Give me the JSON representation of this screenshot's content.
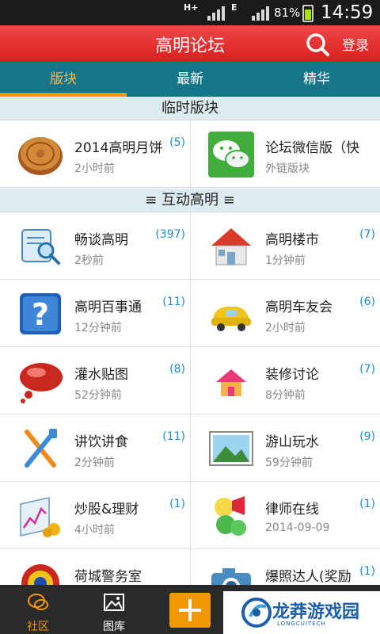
{
  "status_bar": {
    "network_1": "H+",
    "network_2": "E",
    "battery": "81%",
    "time": "14:59"
  },
  "header": {
    "title": "高明论坛",
    "login_label": "登录"
  },
  "tabs": [
    {
      "label": "版块"
    },
    {
      "label": "最新"
    },
    {
      "label": "精华"
    }
  ],
  "sections": [
    {
      "title": "临时版块",
      "boards": [
        {
          "name": "2014高明月饼",
          "time": "2小时前",
          "count": "(5)",
          "icon": "mooncake-icon"
        },
        {
          "name": "论坛微信版（快",
          "time": "外链版块",
          "count": "",
          "icon": "wechat-icon"
        }
      ]
    },
    {
      "title": "≡ 互动高明 ≡",
      "boards": [
        {
          "name": "畅谈高明",
          "time": "2秒前",
          "count": "(397)",
          "icon": "scroll-magnifier-icon"
        },
        {
          "name": "高明楼市",
          "time": "1分钟前",
          "count": "(7)",
          "icon": "house-icon"
        },
        {
          "name": "高明百事通",
          "time": "12分钟前",
          "count": "(11)",
          "icon": "question-mark-icon"
        },
        {
          "name": "高明车友会",
          "time": "2小时前",
          "count": "(6)",
          "icon": "car-icon"
        },
        {
          "name": "灌水贴图",
          "time": "52分钟前",
          "count": "(8)",
          "icon": "speech-bubble-icon"
        },
        {
          "name": "装修讨论",
          "time": "8分钟前",
          "count": "(7)",
          "icon": "pink-house-icon"
        },
        {
          "name": "讲饮讲食",
          "time": "2分钟前",
          "count": "(11)",
          "icon": "utensils-icon"
        },
        {
          "name": "游山玩水",
          "time": "59分钟前",
          "count": "(9)",
          "icon": "landscape-icon"
        },
        {
          "name": "炒股&理财",
          "time": "4小时前",
          "count": "(1)",
          "icon": "stock-chart-icon"
        },
        {
          "name": "律师在线",
          "time": "2014-09-09",
          "count": "(1)",
          "icon": "megaphone-icon"
        },
        {
          "name": "荷城警务室",
          "time": "",
          "count": "",
          "icon": "police-badge-icon"
        },
        {
          "name": "爆照达人(奖励",
          "time": "",
          "count": "(1)",
          "icon": "camera-icon"
        }
      ]
    }
  ],
  "bottom_nav": [
    {
      "label": "社区",
      "icon": "community-icon"
    },
    {
      "label": "图库",
      "icon": "gallery-icon"
    }
  ],
  "watermark": {
    "text": "龙莽游戏园",
    "sub": "LONGCUITECH"
  },
  "colors": {
    "header": "#e02828",
    "tabs": "#17758a",
    "accent": "#f39800",
    "count": "#1a8ad8"
  }
}
